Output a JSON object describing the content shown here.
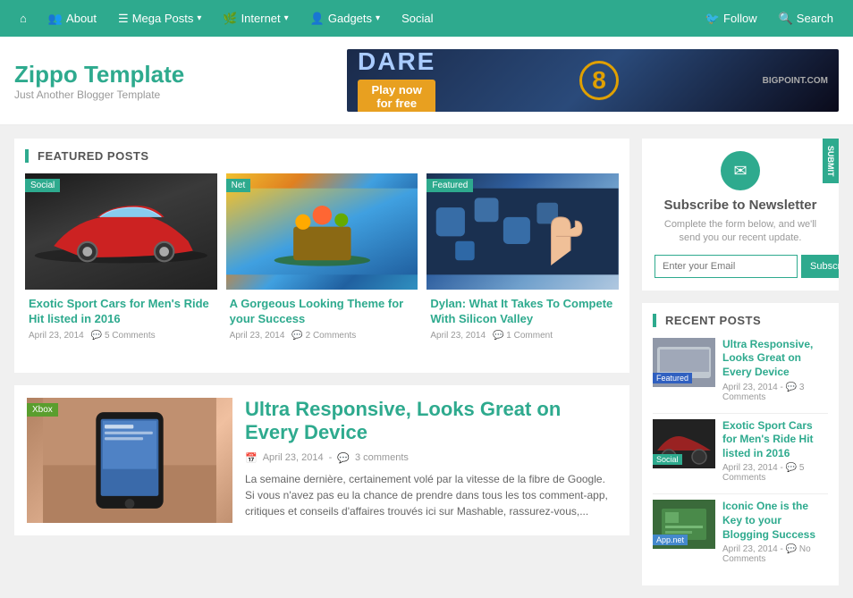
{
  "nav": {
    "home_icon": "⌂",
    "items": [
      {
        "label": "About",
        "has_arrow": false
      },
      {
        "label": "Mega Posts",
        "has_arrow": true
      },
      {
        "label": "Internet",
        "has_arrow": true
      },
      {
        "label": "Gadgets",
        "has_arrow": true
      },
      {
        "label": "Social",
        "has_arrow": false
      }
    ],
    "right_items": [
      {
        "label": "Follow",
        "icon": "🐦"
      },
      {
        "label": "Search",
        "icon": "🔍"
      }
    ]
  },
  "header": {
    "brand_title": "Zippo Template",
    "brand_subtitle": "Just Another Blogger Template",
    "banner_text1": "Dare",
    "banner_text2": "Play now",
    "banner_text3": "for free"
  },
  "featured": {
    "section_title": "FEATURED POSTS",
    "cards": [
      {
        "tag": "Social",
        "tag_class": "social",
        "title": "Exotic Sport Cars for Men's Ride Hit listed in 2016",
        "date": "April 23, 2014",
        "comments": "5 Comments",
        "img_class": "img-car"
      },
      {
        "tag": "Net",
        "tag_class": "net",
        "title": "A Gorgeous Looking Theme for your Success",
        "date": "April 23, 2014",
        "comments": "2 Comments",
        "img_class": "img-movie"
      },
      {
        "tag": "Featured",
        "tag_class": "featured",
        "title": "Dylan: What It Takes To Compete With Silicon Valley",
        "date": "April 23, 2014",
        "comments": "1 Comment",
        "img_class": "img-tech"
      }
    ]
  },
  "big_post": {
    "tag": "Xbox",
    "tag_class": "xbox",
    "title": "Ultra Responsive, Looks Great on Every Device",
    "date": "April 23, 2014",
    "comments": "3 comments",
    "text": "La semaine dernière, certainement volé par la vitesse de la fibre de Google. Si vous n'avez pas eu la chance de prendre dans tous les tos comment-app, critiques et conseils d'affaires trouvés ici sur Mashable, rassurez-vous,...",
    "img_class": "img-phone"
  },
  "sidebar": {
    "newsletter": {
      "corner_label": "SUBMIT",
      "icon": "✉",
      "title": "Subscribe to Newsletter",
      "desc": "Complete the form below, and we'll send you our recent update.",
      "placeholder": "Enter your Email",
      "btn_label": "Subscribe"
    },
    "recent_posts": {
      "section_title": "RECENT POSTS",
      "items": [
        {
          "tag": "Featured",
          "tag_class": "featured",
          "title": "Ultra Responsive, Looks Great on Every Device",
          "date": "April 23, 2014",
          "comments": "3 Comments",
          "img_class": "img-recent1"
        },
        {
          "tag": "Social",
          "tag_class": "social",
          "title": "Exotic Sport Cars for Men's Ride Hit listed in 2016",
          "date": "April 23, 2014",
          "comments": "5 Comments",
          "img_class": "img-recent2"
        },
        {
          "tag": "App.net",
          "tag_class": "appnet",
          "title": "Iconic One is the Key to your Blogging Success",
          "date": "April 23, 2014",
          "comments": "No Comments",
          "img_class": "img-recent3"
        }
      ]
    }
  }
}
